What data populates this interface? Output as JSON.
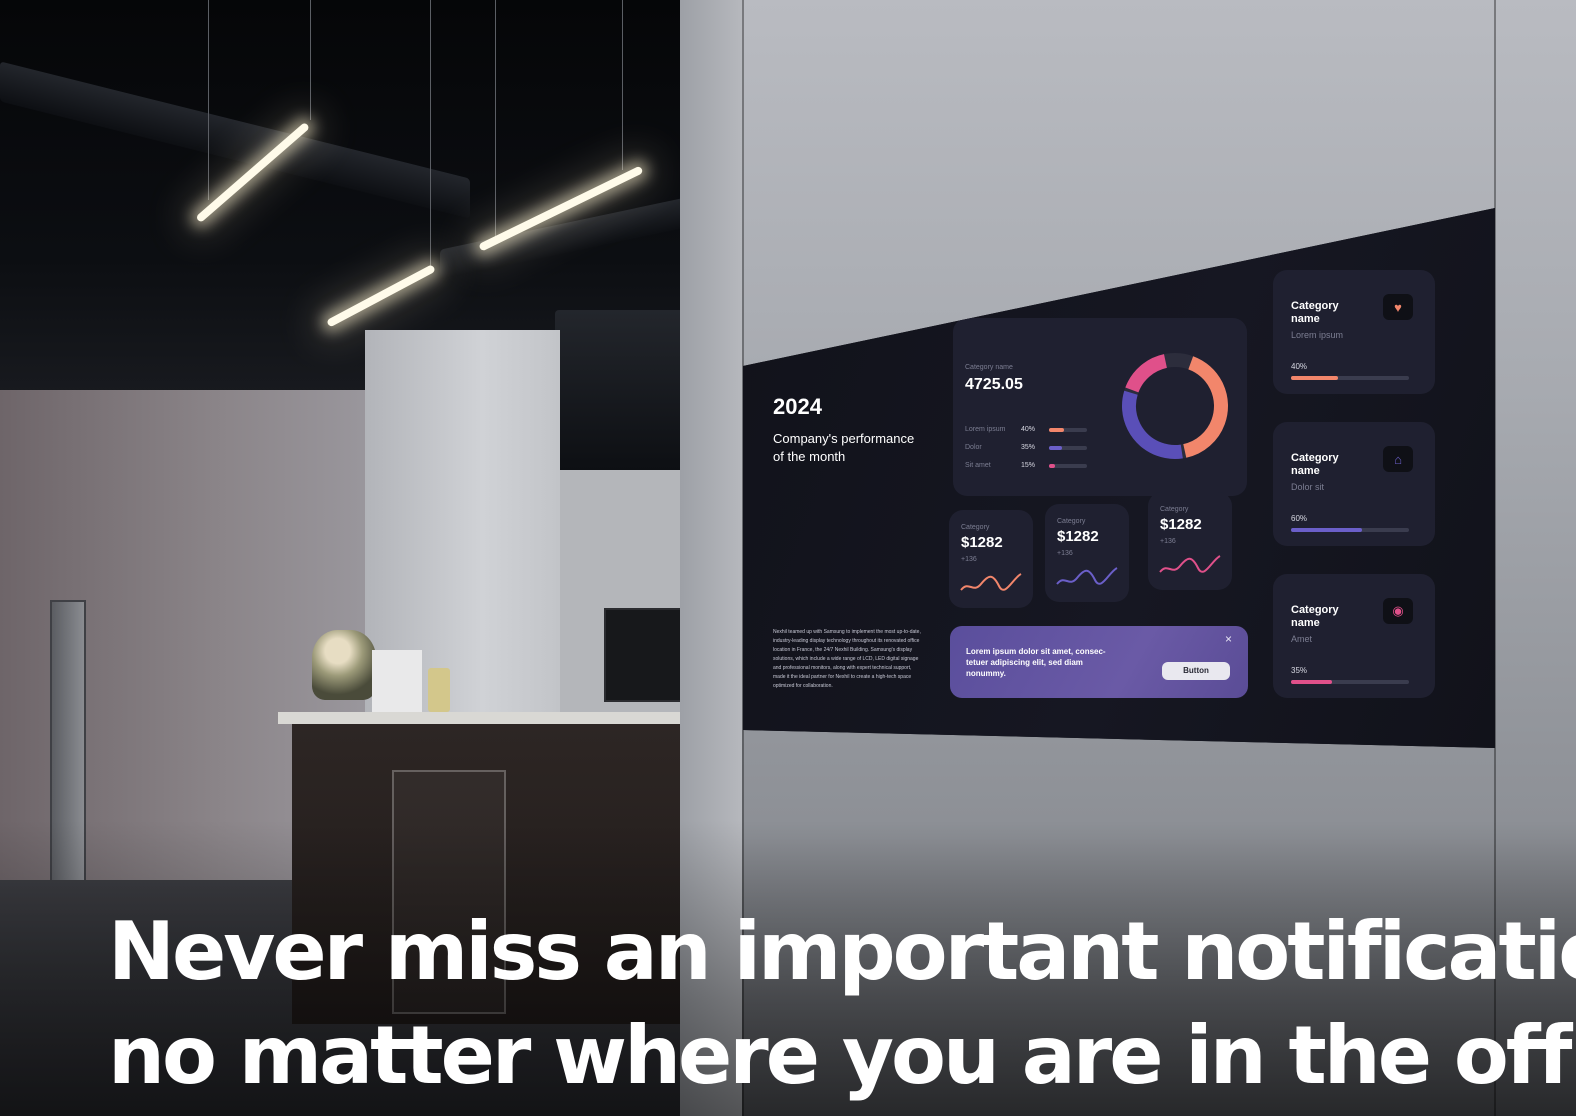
{
  "dashboard": {
    "year": "2024",
    "subtitle_line1": "Company's performance",
    "subtitle_line2": "of the month",
    "body_text": "Nexhil teamed up with Samsung to implement the most up-to-date, industry-leading display technology throughout its renovated office location in France, the 24/7 Nexhil Building. Samsung's display solutions, which include a wide range of LCD, LED digital signage and professional monitors, along with expert technical support, made it the ideal partner for Nexhil to create a high-tech space optimized for collaboration.",
    "summary": {
      "label": "Category name",
      "value": "4725.05",
      "rows": [
        {
          "label": "Lorem ipsum",
          "percent_text": "40%",
          "percent": 0.4,
          "color": "#f2866b"
        },
        {
          "label": "Dolor",
          "percent_text": "35%",
          "percent": 0.35,
          "color": "#6b5fc9"
        },
        {
          "label": "Sit amet",
          "percent_text": "15%",
          "percent": 0.15,
          "color": "#e0508a"
        }
      ],
      "donut_colors": [
        "#f2866b",
        "#5a4fb8",
        "#e0508a"
      ]
    },
    "stats": [
      {
        "label": "Category",
        "value": "$1282",
        "delta": "+136",
        "color": "#f2866b"
      },
      {
        "label": "Category",
        "value": "$1282",
        "delta": "+136",
        "color": "#6b5fc9"
      },
      {
        "label": "Category",
        "value": "$1282",
        "delta": "+136",
        "color": "#e0508a"
      }
    ],
    "notification": {
      "text_line1": "Lorem ipsum dolor sit amet, consec-",
      "text_line2": "tetuer adipiscing elit, sed diam",
      "text_line3": "nonummy.",
      "button_label": "Button",
      "close_glyph": "×"
    },
    "categories": [
      {
        "title_line1": "Category",
        "title_line2": "name",
        "subtitle": "Lorem ipsum",
        "percent_text": "40%",
        "percent": 0.4,
        "color": "#f2866b",
        "icon": "heart-icon",
        "glyph": "♥"
      },
      {
        "title_line1": "Category",
        "title_line2": "name",
        "subtitle": "Dolor sit",
        "percent_text": "60%",
        "percent": 0.6,
        "color": "#6b5fc9",
        "icon": "home-icon",
        "glyph": "⌂"
      },
      {
        "title_line1": "Category",
        "title_line2": "name",
        "subtitle": "Amet",
        "percent_text": "35%",
        "percent": 0.35,
        "color": "#e0508a",
        "icon": "camera-icon",
        "glyph": "◉"
      }
    ]
  },
  "headline": {
    "line1": "Never miss an important notification,",
    "line2": "no matter where you are in the office"
  }
}
